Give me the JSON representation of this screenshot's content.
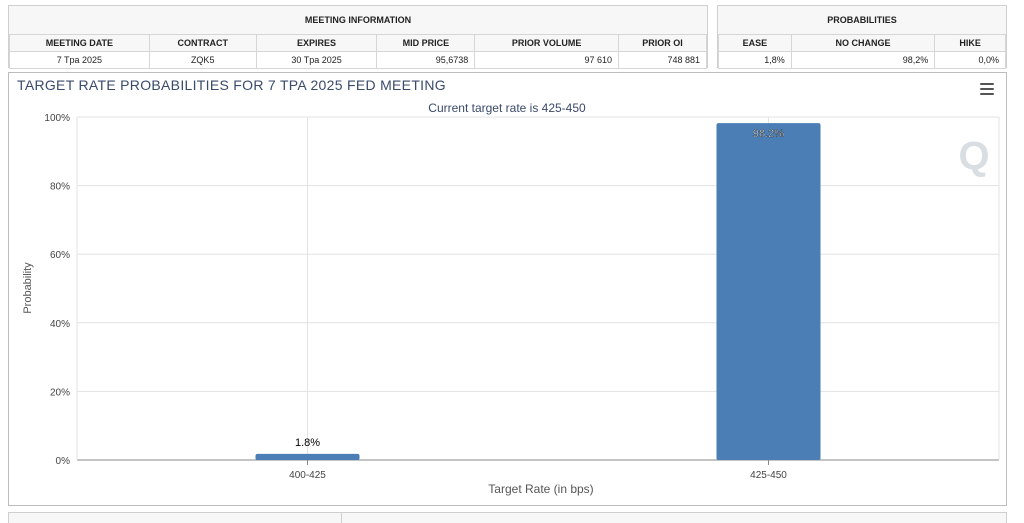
{
  "meeting_info": {
    "title": "MEETING INFORMATION",
    "headers": [
      "MEETING DATE",
      "CONTRACT",
      "EXPIRES",
      "MID PRICE",
      "PRIOR VOLUME",
      "PRIOR OI"
    ],
    "row": [
      "7 Tpa 2025",
      "ZQK5",
      "30 Tpa 2025",
      "95,6738",
      "97 610",
      "748 881"
    ]
  },
  "probabilities": {
    "title": "PROBABILITIES",
    "headers": [
      "EASE",
      "NO CHANGE",
      "HIKE"
    ],
    "row": [
      "1,8%",
      "98,2%",
      "0,0%"
    ]
  },
  "chart_data": {
    "type": "bar",
    "title": "TARGET RATE PROBABILITIES FOR 7 TPA 2025 FED MEETING",
    "subtitle": "Current target rate is 425-450",
    "xlabel": "Target Rate (in bps)",
    "ylabel": "Probability",
    "categories": [
      "400-425",
      "425-450"
    ],
    "values": [
      1.8,
      98.2
    ],
    "data_labels": [
      "1.8%",
      "98.2%"
    ],
    "ylim": [
      0,
      100
    ],
    "yticks": [
      "0%",
      "20%",
      "40%",
      "60%",
      "80%",
      "100%"
    ],
    "grid": true,
    "bar_color": "#4a7eb5"
  },
  "watermark": "Q"
}
